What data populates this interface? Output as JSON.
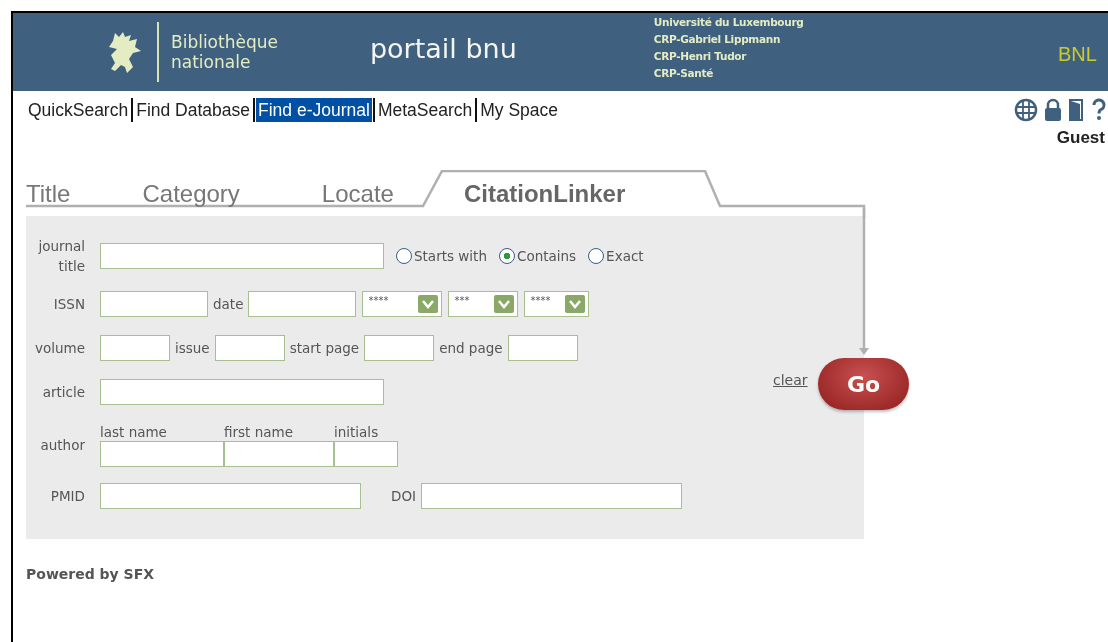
{
  "header": {
    "library_name": [
      "Bibliothèque",
      "nationale"
    ],
    "title": "portail bnu",
    "partners": [
      "Université du Luxembourg",
      "CRP-Gabriel Lippmann",
      "CRP-Henri Tudor",
      "CRP-Santé"
    ],
    "brand": "BNL"
  },
  "nav": [
    {
      "label": "QuickSearch",
      "selected": false
    },
    {
      "label": "Find Database",
      "selected": false
    },
    {
      "label": "Find e-Journal",
      "selected": true
    },
    {
      "label": "MetaSearch",
      "selected": false
    },
    {
      "label": "My Space",
      "selected": false
    }
  ],
  "user": "Guest",
  "tabs": [
    {
      "label": "Title",
      "selected": false
    },
    {
      "label": "Category",
      "selected": false
    },
    {
      "label": "Locate",
      "selected": false
    },
    {
      "label": "CitationLinker",
      "selected": true
    }
  ],
  "form": {
    "journal_title_label": "journal title",
    "match_options": [
      {
        "label": "Starts with",
        "selected": false
      },
      {
        "label": "Contains",
        "selected": true
      },
      {
        "label": "Exact",
        "selected": false
      }
    ],
    "issn_label": "ISSN",
    "date_label": "date",
    "date_selects": [
      "****",
      "***",
      "****"
    ],
    "volume_label": "volume",
    "issue_label": "issue",
    "start_page_label": "start page",
    "end_page_label": "end page",
    "article_label": "article",
    "author_label": "author",
    "last_name_label": "last name",
    "first_name_label": "first name",
    "initials_label": "initials",
    "pmid_label": "PMID",
    "doi_label": "DOI"
  },
  "clear": "clear",
  "go": "Go",
  "footer": "Powered by SFX"
}
